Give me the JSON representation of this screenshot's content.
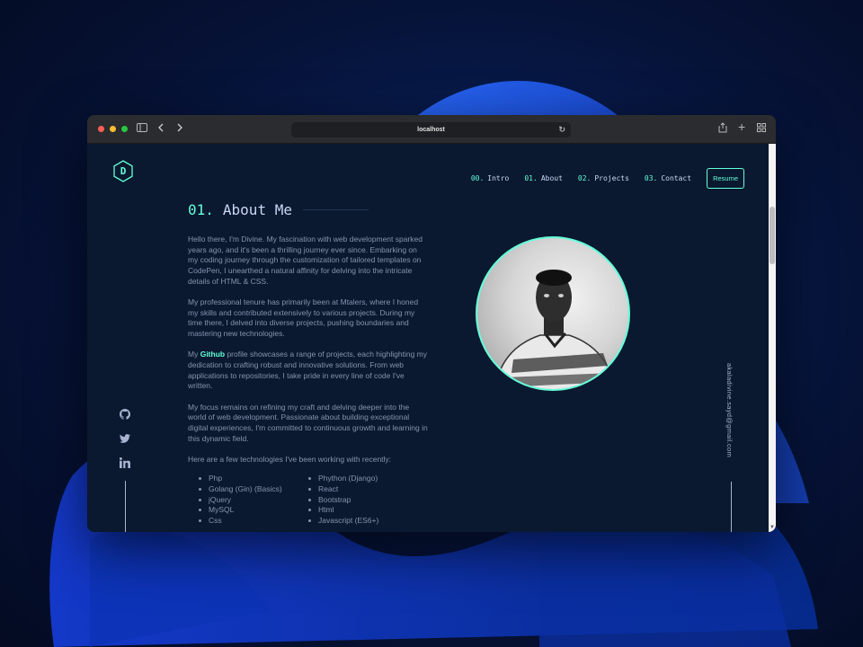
{
  "browser": {
    "url": "localhost",
    "traffic_colors": [
      "#ff5f57",
      "#febc2e",
      "#28c840"
    ]
  },
  "logo": {
    "letter": "D"
  },
  "nav": {
    "items": [
      {
        "num": "00.",
        "label": "Intro"
      },
      {
        "num": "01.",
        "label": "About"
      },
      {
        "num": "02.",
        "label": "Projects"
      },
      {
        "num": "03.",
        "label": "Contact"
      }
    ],
    "resume_label": "Resume"
  },
  "about": {
    "heading_num": "01.",
    "heading_text": "About Me",
    "p1": "Hello there, I'm Divine. My fascination with web development sparked years ago, and it's been a thrilling journey ever since. Embarking on my coding journey through the customization of tailored templates on CodePen, I unearthed a natural affinity for delving into the intricate details of HTML & CSS.",
    "p2": "My professional tenure has primarily been at Mtalers, where I honed my skills and contributed extensively to various projects. During my time there, I delved into diverse projects, pushing boundaries and mastering new technologies.",
    "p3_before": "My ",
    "p3_link": "Github",
    "p3_after": " profile showcases a range of projects, each highlighting my dedication to crafting robust and innovative solutions. From web applications to repositories, I take pride in every line of code I've written.",
    "p4": "My focus remains on refining my craft and delving deeper into the world of web development. Passionate about building exceptional digital experiences, I'm committed to continuous growth and learning in this dynamic field.",
    "tech_intro": "Here are a few technologies I've been working with recently:",
    "tech_col1": [
      "Php",
      "Golang (Gin) (Basics)",
      "jQuery",
      "MySQL",
      "Css"
    ],
    "tech_col2": [
      "Phython (Django)",
      "React",
      "Bootstrap",
      "Html",
      "Javascript (ES6+)"
    ]
  },
  "sidebar": {
    "email": "akaladivine.sayd@gmail.com",
    "social_icons": [
      "github-icon",
      "twitter-icon",
      "linkedin-icon"
    ]
  },
  "colors": {
    "accent": "#64ffda",
    "background": "#0a192f",
    "text": "#8892b0",
    "heading": "#ccd6f6"
  }
}
